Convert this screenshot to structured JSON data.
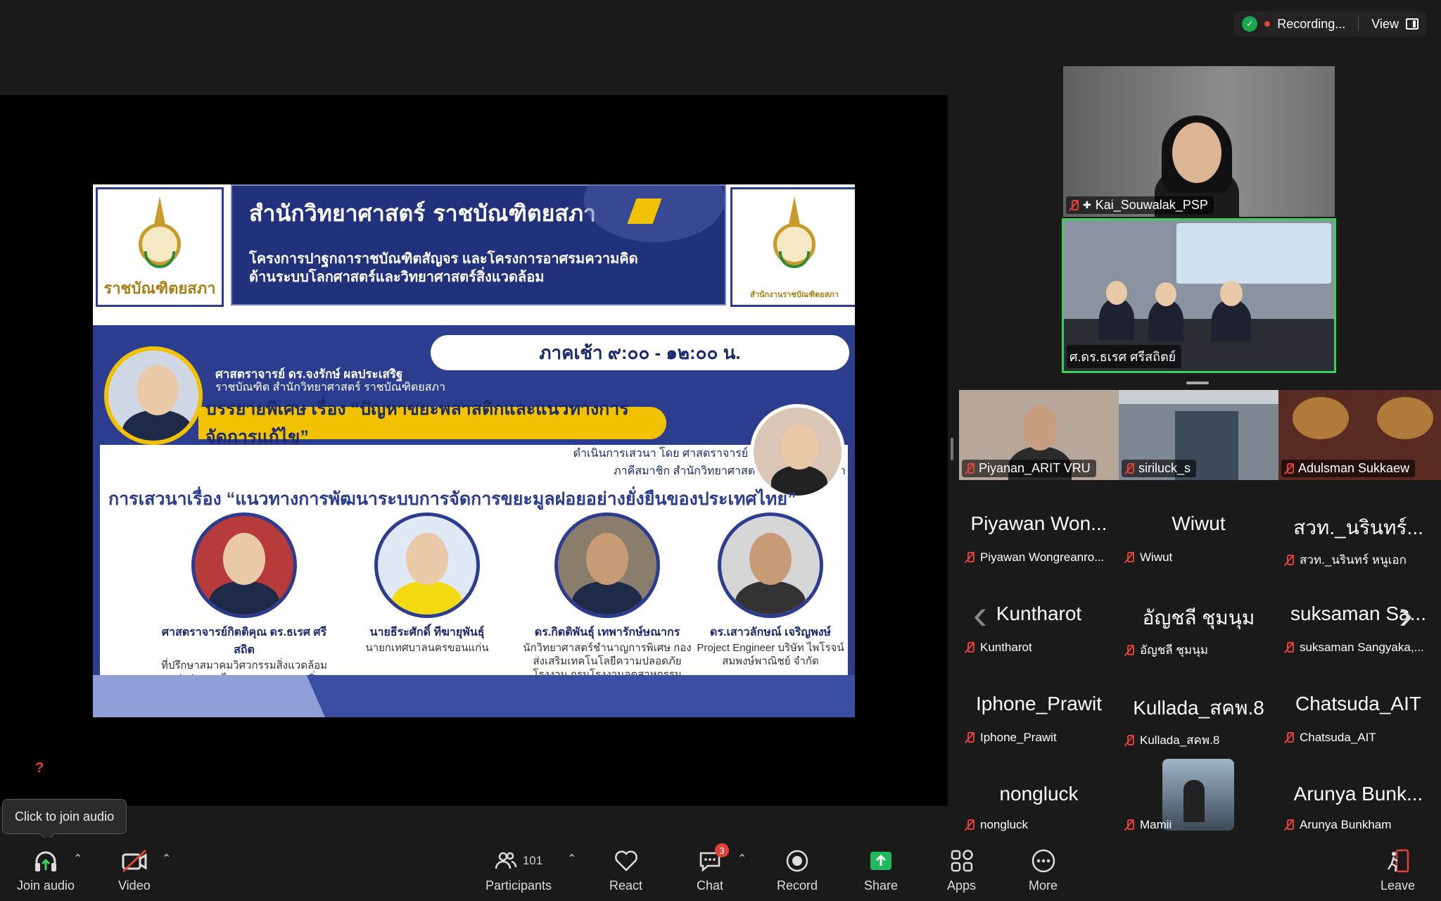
{
  "topbar": {
    "recording_label": "Recording...",
    "view_label": "View"
  },
  "slide": {
    "logo_left_text": "ราชบัณฑิตยสภา",
    "logo_right_text": "สำนักงานราชบัณฑิตยสภา",
    "header_title": "สำนักวิทยาศาสตร์ ราชบัณฑิตยสภา",
    "header_subtitle_1": "โครงการปาฐกถาราชบัณฑิตสัญจร และโครงการอาศรมความคิด",
    "header_subtitle_2": "ด้านระบบโลกศาสตร์และวิทยาศาสตร์สิ่งแวดล้อม",
    "time": "ภาคเช้า ๙:๐๐ - ๑๒:๐๐ น.",
    "prof_name": "ศาสตราจารย์ ดร.จงรักษ์ ผลประเสริฐ",
    "prof_role": "ราชบัณฑิต สำนักวิทยาศาสตร์ ราชบัณฑิตยสภา",
    "lecture": "บรรยายพิเศษ เรื่อง “ปัญหาขยะพลาสติกและแนวทางการจัดการแก้ไข”",
    "moderator_1": "ดำเนินการเสวนา โดย ศาสตราจารย์ ดร.อลิศรา เรืองแสง",
    "moderator_2": "ภาคีสมาชิก สำนักวิทยาศาสตร์ ราชบัณฑิตยสภา",
    "discussion": "การเสวนาเรื่อง “แนวทางการพัฒนาระบบการจัดการขยะมูลฝอยอย่างยั่งยืนของประเทศไทย”",
    "panelists": [
      {
        "name": "ศาสตราจารย์กิตติคุณ ดร.ธเรศ ศรีสถิต",
        "desc": "ที่ปรึกษาสมาคมวิศวกรรมสิ่งแวดล้อมแห่งประเทศไทย คณะกรรมการสิ่งแวดล้อมแห่งชาติ"
      },
      {
        "name": "นายธีระศักดิ์ ทีฆายุพันธุ์",
        "desc": "นายกเทศบาลนครขอนแก่น"
      },
      {
        "name": "ดร.กิตติพันธุ์ เทพารักษ์ษณากร",
        "desc": "นักวิทยาศาสตร์ชำนาญการพิเศษ กองส่งเสริมเทคโนโลยีความปลอดภัยโรงงาน กรมโรงงานอุตสาหกรรม"
      },
      {
        "name": "ดร.เสาวลักษณ์ เจริญพงษ์",
        "desc": "Project Engineer บริษัท ไพโรจน์สมพงษ์พาณิชย์ จำกัด"
      }
    ]
  },
  "videos": {
    "pinned": "Kai_Souwalak_PSP",
    "active": "ศ.ดร.ธเรศ ศรีสถิตย์",
    "row": [
      "Piyanan_ARIT VRU",
      "siriluck_s",
      "Adulsman Sukkaew"
    ]
  },
  "grid": [
    {
      "big": "Piyawan Won...",
      "small": "Piyawan Wongreanro..."
    },
    {
      "big": "Wiwut",
      "small": "Wiwut"
    },
    {
      "big": "สวท._นรินทร์...",
      "small": "สวท._นรินทร์ หนูเอก"
    },
    {
      "big": "Kuntharot",
      "small": "Kuntharot"
    },
    {
      "big": "อัญชลี ชุมนุม",
      "small": "อัญชลี ชุมนุม"
    },
    {
      "big": "suksaman Sa...",
      "small": "suksaman Sangyaka,..."
    },
    {
      "big": "Iphone_Prawit",
      "small": "Iphone_Prawit"
    },
    {
      "big": "Kullada_สคพ.8",
      "small": "Kullada_สคพ.8"
    },
    {
      "big": "Chatsuda_AIT",
      "small": "Chatsuda_AIT"
    },
    {
      "big": "nongluck",
      "small": "nongluck"
    },
    {
      "big": "",
      "small": "Mamii"
    },
    {
      "big": "Arunya Bunk...",
      "small": "Arunya Bunkham"
    }
  ],
  "tooltip": "Click to join audio",
  "toolbar": {
    "join_audio": "Join audio",
    "video": "Video",
    "participants": "Participants",
    "participants_count": "101",
    "react": "React",
    "chat": "Chat",
    "chat_badge": "3",
    "record": "Record",
    "share": "Share",
    "apps": "Apps",
    "more": "More",
    "leave": "Leave"
  }
}
